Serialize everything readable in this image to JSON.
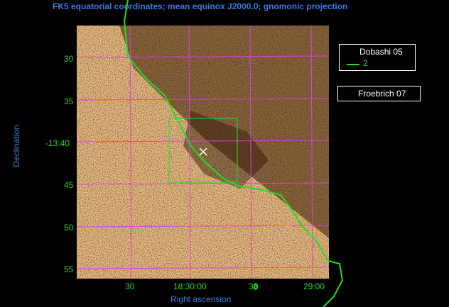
{
  "header": {
    "title": "FK5 equatorial coordinates; mean equinox J2000.0; gnomonic projection"
  },
  "axes": {
    "xlabel": "Right ascension",
    "ylabel": "Declination",
    "y_ticks": [
      "30",
      "35",
      "-13:40",
      "45",
      "50",
      "55"
    ],
    "x_ticks": [
      "30",
      "18:30:00",
      "30",
      "29:00"
    ]
  },
  "legends": {
    "dobashi": {
      "name": "Dobashi 05",
      "series": "2"
    },
    "froebrich": {
      "name": "Froebrich 07"
    }
  },
  "colors": {
    "background": "#000000",
    "title_blue": "#3d7bdc",
    "tick_green": "#2fd62f",
    "grid_magenta": "#e040e0",
    "contour_green": "#22dd22",
    "image_light": "#f3d6a8",
    "image_dark": "#3a1e08"
  }
}
